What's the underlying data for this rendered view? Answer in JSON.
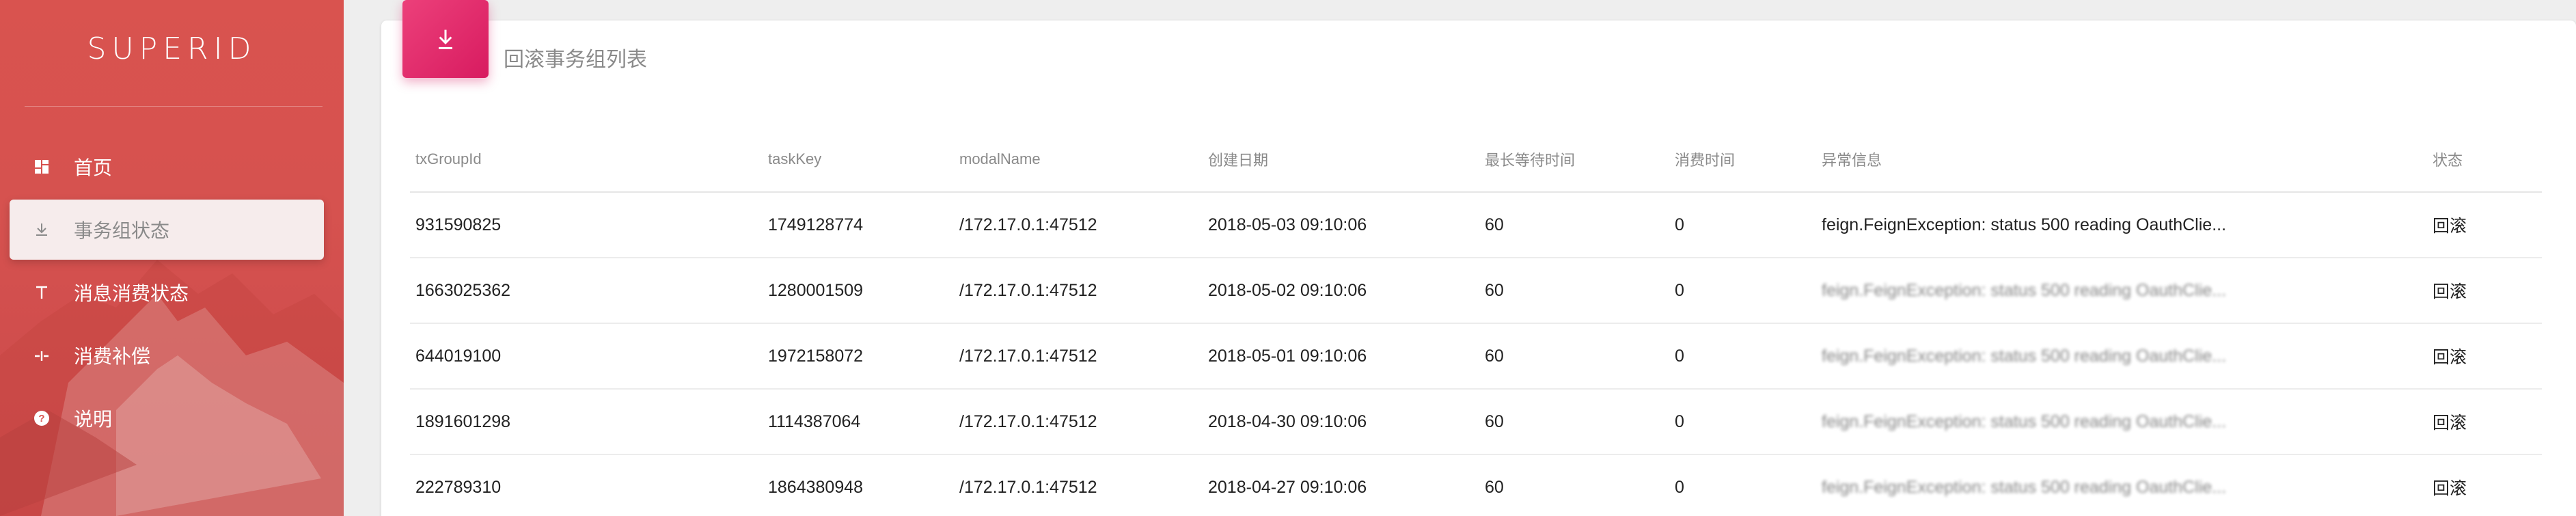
{
  "brand": "SUPERID",
  "nav": [
    {
      "label": "首页",
      "icon": "dashboard-icon",
      "active": false
    },
    {
      "label": "事务组状态",
      "icon": "download-icon",
      "active": true
    },
    {
      "label": "消息消费状态",
      "icon": "text-icon",
      "active": false
    },
    {
      "label": "消费补偿",
      "icon": "compensate-icon",
      "active": false
    },
    {
      "label": "说明",
      "icon": "help-icon",
      "active": false
    }
  ],
  "card": {
    "icon": "download-icon",
    "title": "回滚事务组列表"
  },
  "table": {
    "headers": [
      "txGroupId",
      "taskKey",
      "modalName",
      "创建日期",
      "最长等待时间",
      "消费时间",
      "异常信息",
      "状态"
    ],
    "rows": [
      {
        "txGroupId": "931590825",
        "taskKey": "1749128774",
        "modalName": "/172.17.0.1:47512",
        "created": "2018-05-03 09:10:06",
        "maxWait": "60",
        "consumeTime": "0",
        "error": "feign.FeignException: status 500 reading OauthClie...",
        "status": "回滚"
      },
      {
        "txGroupId": "1663025362",
        "taskKey": "1280001509",
        "modalName": "/172.17.0.1:47512",
        "created": "2018-05-02 09:10:06",
        "maxWait": "60",
        "consumeTime": "0",
        "error": "feign.FeignException: status 500 reading OauthClie...",
        "status": "回滚"
      },
      {
        "txGroupId": "644019100",
        "taskKey": "1972158072",
        "modalName": "/172.17.0.1:47512",
        "created": "2018-05-01 09:10:06",
        "maxWait": "60",
        "consumeTime": "0",
        "error": "feign.FeignException: status 500 reading OauthClie...",
        "status": "回滚"
      },
      {
        "txGroupId": "1891601298",
        "taskKey": "1114387064",
        "modalName": "/172.17.0.1:47512",
        "created": "2018-04-30 09:10:06",
        "maxWait": "60",
        "consumeTime": "0",
        "error": "feign.FeignException: status 500 reading OauthClie...",
        "status": "回滚"
      },
      {
        "txGroupId": "222789310",
        "taskKey": "1864380948",
        "modalName": "/172.17.0.1:47512",
        "created": "2018-04-27 09:10:06",
        "maxWait": "60",
        "consumeTime": "0",
        "error": "feign.FeignException: status 500 reading OauthClie...",
        "status": "回滚"
      }
    ]
  },
  "colors": {
    "sidebar": "#d9534f",
    "accent": "#e91e63",
    "active_item_bg": "#f6ecec"
  }
}
